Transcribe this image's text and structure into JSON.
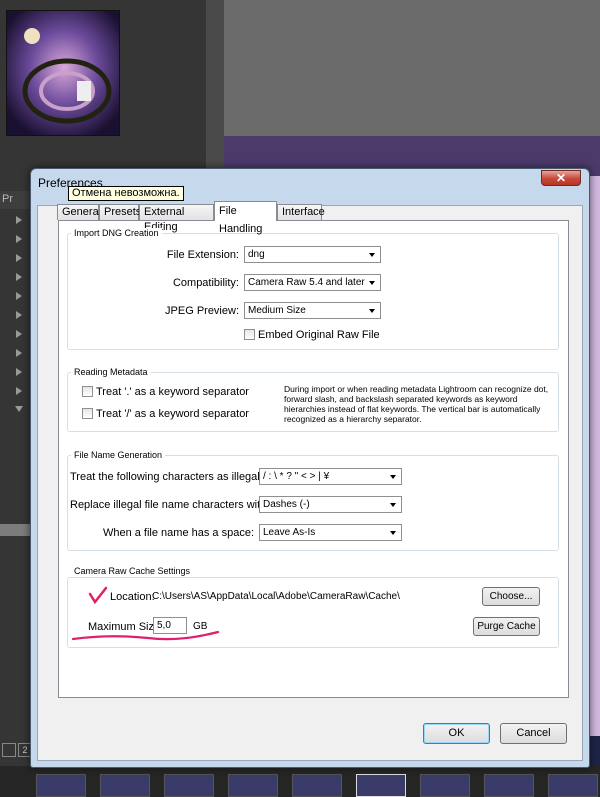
{
  "lightroom": {
    "panel_header": "Pr",
    "filmstrip_number": "2"
  },
  "dialog": {
    "title": "Preferences",
    "close_glyph": "✕",
    "tooltip": "Отмена невозможна.",
    "tabs": [
      {
        "label": "General",
        "active": false
      },
      {
        "label": "Presets",
        "active": false
      },
      {
        "label": "External Editing",
        "active": false
      },
      {
        "label": "File Handling",
        "active": true
      },
      {
        "label": "Interface",
        "active": false
      }
    ],
    "import_dng": {
      "title": "Import DNG Creation",
      "file_extension_label": "File Extension:",
      "file_extension_value": "dng",
      "compatibility_label": "Compatibility:",
      "compatibility_value": "Camera Raw 5.4 and later",
      "jpeg_preview_label": "JPEG Preview:",
      "jpeg_preview_value": "Medium Size",
      "embed_raw_label": "Embed Original Raw File",
      "embed_raw_checked": false
    },
    "reading_metadata": {
      "title": "Reading Metadata",
      "dot_separator_label": "Treat '.' as a keyword separator",
      "slash_separator_label": "Treat '/' as a keyword separator",
      "note": "During import or when reading metadata Lightroom can recognize dot, forward slash, and backslash separated keywords as keyword hierarchies instead of flat keywords. The vertical bar is automatically recognized as a hierarchy separator."
    },
    "file_name_generation": {
      "title": "File Name Generation",
      "illegal_label": "Treat the following characters as illegal:",
      "illegal_value": "/ : \\ * ? \" < > | ¥",
      "replace_label": "Replace illegal file name characters with:",
      "replace_value": "Dashes (-)",
      "space_label": "When a file name has a space:",
      "space_value": "Leave As-Is"
    },
    "cache": {
      "title": "Camera Raw Cache Settings",
      "location_label": "Location:",
      "location_value": "C:\\Users\\AS\\AppData\\Local\\Adobe\\CameraRaw\\Cache\\",
      "choose_button": "Choose...",
      "max_size_label": "Maximum Size:",
      "max_size_value": "5,0",
      "max_size_unit": "GB",
      "purge_button": "Purge Cache"
    },
    "ok_button": "OK",
    "cancel_button": "Cancel"
  },
  "colors": {
    "annotation": "#e0206a",
    "dialog_frame": "#c6d9ec",
    "lightroom_bg": "#353535"
  }
}
